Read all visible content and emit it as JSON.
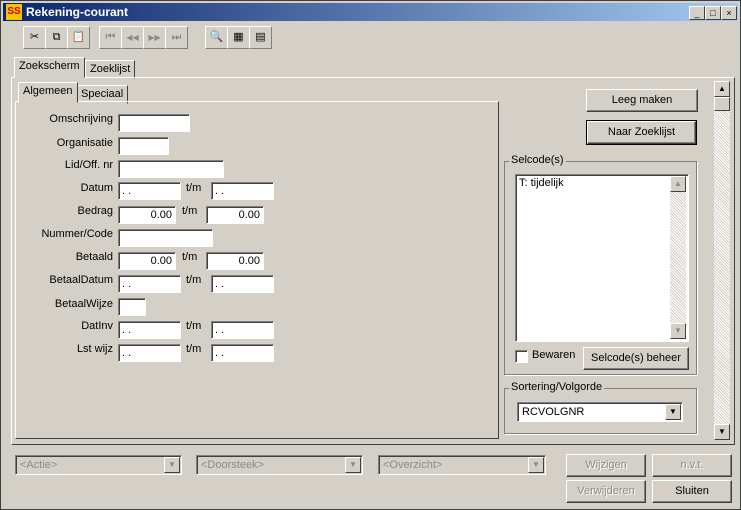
{
  "window": {
    "title": "Rekening-courant",
    "app_icon": "SS",
    "minimize": "_",
    "maximize": "□",
    "close": "×"
  },
  "toolbar": {
    "cut": "✂",
    "copy": "⧉",
    "paste": "📋",
    "first": "⏮",
    "prev": "◀◀",
    "next": "▶▶",
    "last": "⏭",
    "search": "🔍",
    "table": "▦",
    "form": "▤"
  },
  "tabs": {
    "outer": [
      "Zoekscherm",
      "Zoeklijst"
    ],
    "inner": [
      "Algemeen",
      "Speciaal"
    ]
  },
  "form": {
    "omschrijving": {
      "label": "Omschrijving",
      "value": ""
    },
    "organisatie": {
      "label": "Organisatie",
      "value": ""
    },
    "lid": {
      "label": "Lid/Off. nr",
      "value": ""
    },
    "datum": {
      "label": "Datum",
      "from": " . .",
      "tm": "t/m",
      "to": " . ."
    },
    "bedrag": {
      "label": "Bedrag",
      "from": "0.00",
      "tm": "t/m",
      "to": "0.00"
    },
    "nummer": {
      "label": "Nummer/Code",
      "value": ""
    },
    "betaald": {
      "label": "Betaald",
      "from": "0.00",
      "tm": "t/m",
      "to": "0.00"
    },
    "betaaldatum": {
      "label": "BetaalDatum",
      "from": " . .",
      "tm": "t/m",
      "to": " . ."
    },
    "betaalwijze": {
      "label": "BetaalWijze",
      "value": ""
    },
    "datinv": {
      "label": "DatInv",
      "from": " . .",
      "tm": "t/m",
      "to": " . ."
    },
    "lstwijz": {
      "label": "Lst wijz",
      "from": " . .",
      "tm": "t/m",
      "to": " . ."
    }
  },
  "right": {
    "leeg_maken": "Leeg maken",
    "naar_zoeklijst": "Naar Zoeklijst",
    "selcodes_label": "Selcode(s)",
    "selcodes_items": [
      "T: tijdelijk"
    ],
    "bewaren": "Bewaren",
    "bewaren_checked": false,
    "selcodes_beheer": "Selcode(s) beheer",
    "sortering_label": "Sortering/Volgorde",
    "sortering_value": "RCVOLGNR"
  },
  "scroll": {
    "up": "▲",
    "down": "▼"
  },
  "bottom": {
    "actie": "<Actie>",
    "doorsteek": "<Doorsteek>",
    "overzicht": "<Overzicht>",
    "wijzigen": "Wijzigen",
    "nvt": "n.v.t.",
    "verwijderen": "Verwijderen",
    "sluiten": "Sluiten"
  }
}
